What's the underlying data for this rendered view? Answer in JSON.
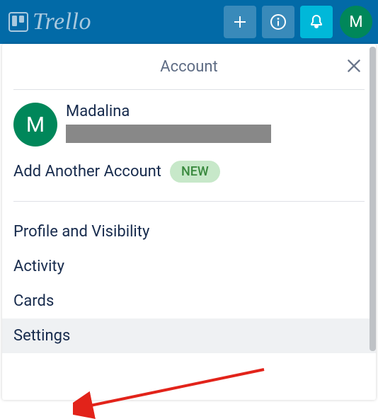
{
  "brand": {
    "name": "Trello"
  },
  "topbar": {
    "avatar_initial": "M"
  },
  "panel": {
    "title": "Account",
    "user": {
      "name": "Madalina",
      "avatar_initial": "M"
    },
    "add_account_label": "Add Another Account",
    "new_badge": "NEW",
    "menu": [
      {
        "label": "Profile and Visibility"
      },
      {
        "label": "Activity"
      },
      {
        "label": "Cards"
      },
      {
        "label": "Settings"
      }
    ]
  }
}
